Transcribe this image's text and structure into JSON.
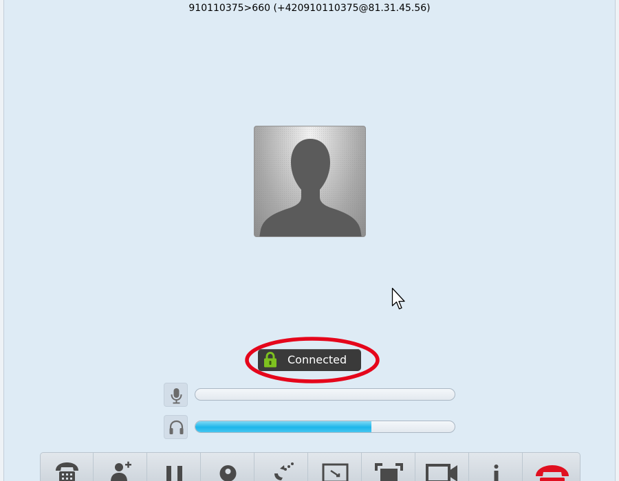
{
  "call": {
    "remote_id": "910110375>660 (+420910110375@81.31.45.56)",
    "status": "Connected"
  },
  "levels": {
    "microphone_level": 0.0,
    "speaker_level": 0.68
  },
  "toolbar": {
    "buttons": [
      "phone-icon",
      "add-contact-icon",
      "hold-icon",
      "record-icon",
      "transfer-icon",
      "screen-share-icon",
      "fullscreen-icon",
      "video-icon",
      "info-icon",
      "hang-up-icon"
    ]
  },
  "colors": {
    "background": "#deebf5",
    "status_ring": "#e5061b",
    "lock_green": "#7ec21f",
    "level_fill": "#1db6ea",
    "hangup_red": "#e01020"
  }
}
